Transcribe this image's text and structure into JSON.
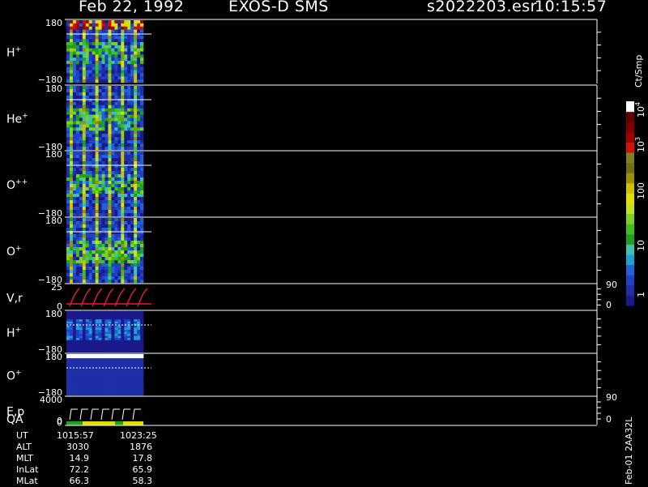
{
  "header": {
    "date": "Feb 22, 1992",
    "instrument": "EXOS-D SMS",
    "file": "s2022203.esr",
    "time": "10:15:57"
  },
  "panels": [
    {
      "label": "H",
      "sup": "+",
      "ymax": "180",
      "ymin": "−180"
    },
    {
      "label": "He",
      "sup": "+",
      "ymax": "180",
      "ymin": "−180"
    },
    {
      "label": "O",
      "sup": "++",
      "ymax": "180",
      "ymin": "−180"
    },
    {
      "label": "O",
      "sup": "+",
      "ymax": "180",
      "ymin": "−180"
    },
    {
      "label": "V,r",
      "sup": "",
      "ymax": "25",
      "ymin": "0",
      "right_top": "90",
      "right_bottom": "0"
    },
    {
      "label": "H",
      "sup": "+",
      "ymax": "180",
      "ymin": "−180"
    },
    {
      "label": "O",
      "sup": "+",
      "ymax": "180",
      "ymin": "−180"
    },
    {
      "label": "E,p",
      "sup": "",
      "ymax": "4000",
      "ymin": "0",
      "right_top": "90",
      "right_bottom": "0"
    }
  ],
  "qa_label": "QA",
  "colorbar": {
    "unit": "Ct/Smp",
    "ticks": [
      "10",
      "10",
      "100",
      "10",
      "1"
    ],
    "exponents": [
      "4",
      "3",
      "",
      "",
      ""
    ],
    "colors": [
      "#1a1a8c",
      "#1f2fa8",
      "#2040c8",
      "#2060d8",
      "#20a0d0",
      "#40c0b0",
      "#20a020",
      "#40c020",
      "#80d020",
      "#c0e020",
      "#e0e000",
      "#d0c000",
      "#a09000",
      "#707010",
      "#808020",
      "#d01010",
      "#a00000",
      "#800000",
      "#600000",
      "#ffffff"
    ]
  },
  "summary": {
    "rows": [
      {
        "key": "UT",
        "v1": "1015:57",
        "v2": "1023:25"
      },
      {
        "key": "ALT",
        "v1": "3030",
        "v2": "1876"
      },
      {
        "key": "MLT",
        "v1": "14.9",
        "v2": "17.8"
      },
      {
        "key": "InLat",
        "v1": "72.2",
        "v2": "65.9"
      },
      {
        "key": "MLat",
        "v1": "66.3",
        "v2": "58.3"
      }
    ]
  },
  "footer_vertical": "Feb-01  2AA32L",
  "chart_data": {
    "type": "heatmap",
    "title": "Feb 22, 1992   EXOS-D SMS",
    "x_range_ut": [
      "1015:57",
      "1023:25"
    ],
    "pitch_angle_range": [
      -180,
      180
    ],
    "colorbar_range": [
      1,
      10000
    ],
    "colorbar_scale": "log",
    "species_panels": [
      "H+",
      "He+",
      "O++",
      "O+",
      "V,r",
      "H+",
      "O+",
      "E,p",
      "QA"
    ]
  }
}
